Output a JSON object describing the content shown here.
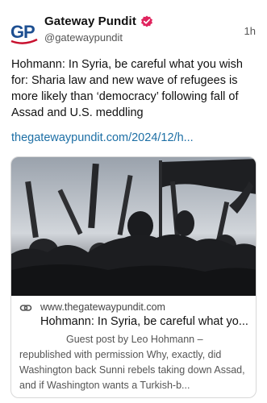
{
  "account": {
    "name": "Gateway Pundit",
    "handle": "@gatewaypundit",
    "avatar_text": "GP",
    "verified_icon": "verified-badge-icon",
    "accent_color": "#e0245e"
  },
  "post": {
    "time": "1h",
    "text": "Hohmann: In Syria, be careful what you wish for: Sharia law and new wave of refugees is more likely than ‘democracy’ following fall of Assad and U.S. meddling",
    "link_text": "thegatewaypundit.com/2024/12/h..."
  },
  "card": {
    "image_icon": "militants-with-rifles-photo",
    "link_icon": "link-icon",
    "domain": "www.thegatewaypundit.com",
    "title": "Hohmann: In Syria, be careful what yo...",
    "description": "Guest post by Leo Hohmann – republished with permission Why, exactly, did Washington back Sunni rebels taking down Assad, and if Washington wants a Turkish-b..."
  }
}
